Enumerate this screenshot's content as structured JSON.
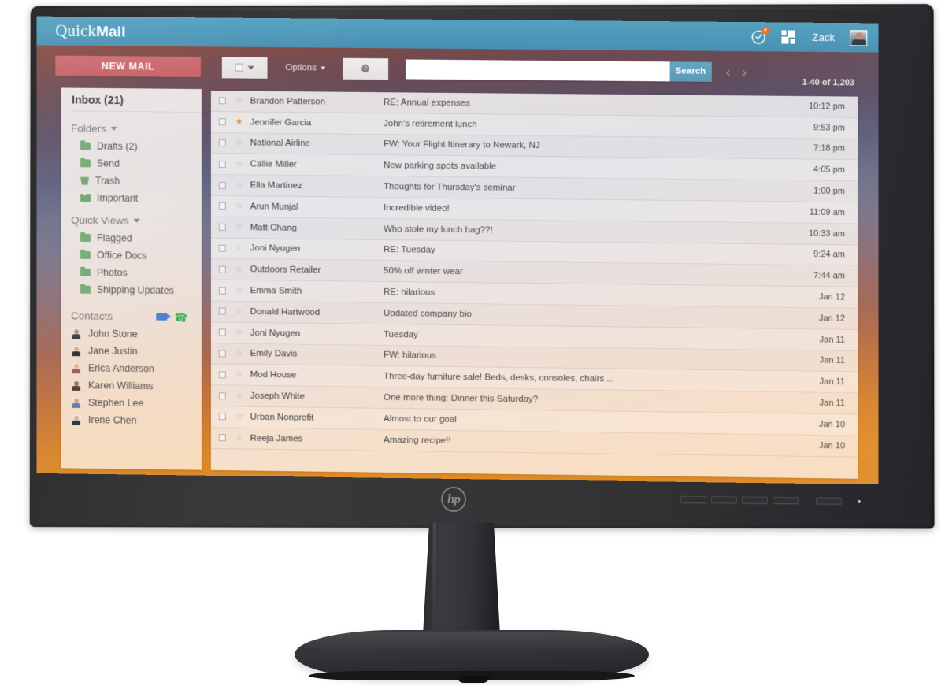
{
  "device": {
    "brand_logo": "hp",
    "brand_logo_icon": "hp-circle-logo",
    "osd_buttons": [
      "menu-button-1",
      "menu-button-2",
      "menu-button-3",
      "menu-button-4"
    ],
    "power_button": "power-button",
    "power_led": "power-led-indicator"
  },
  "app_bar": {
    "brand_light": "Quick",
    "brand_bold": "Mail",
    "notifications_icon": "clock-notification-icon",
    "notification_badge": "3",
    "apps_icon": "apps-grid-icon",
    "user_name": "Zack",
    "avatar_icon": "user-avatar"
  },
  "toolbar": {
    "new_mail_label": "NEW MAIL",
    "select_all_checkbox_icon": "checkbox-icon",
    "select_all_caret_icon": "chevron-down-icon",
    "options_label": "Options",
    "options_caret_icon": "chevron-down-icon",
    "settings_icon": "gear-icon",
    "search_value": "",
    "search_placeholder": "",
    "search_button_label": "Search",
    "prev_icon": "chevron-left-icon",
    "next_icon": "chevron-right-icon",
    "count_label": "1-40 of 1,203"
  },
  "sidebar": {
    "inbox_label": "Inbox (21)",
    "folders_section": {
      "label": "Folders",
      "caret_icon": "caret-down-icon"
    },
    "folders": [
      {
        "label": "Drafts (2)",
        "icon": "folder-icon"
      },
      {
        "label": "Send",
        "icon": "folder-icon"
      },
      {
        "label": "Trash",
        "icon": "trash-icon"
      },
      {
        "label": "Important",
        "icon": "starred-folder-icon"
      }
    ],
    "quick_views_section": {
      "label": "Quick Views",
      "caret_icon": "caret-down-icon"
    },
    "quick_views": [
      {
        "label": "Flagged",
        "icon": "folder-icon"
      },
      {
        "label": "Office Docs",
        "icon": "folder-icon"
      },
      {
        "label": "Photos",
        "icon": "folder-icon"
      },
      {
        "label": "Shipping Updates",
        "icon": "folder-icon"
      }
    ],
    "contacts_section": {
      "label": "Contacts",
      "video_icon": "video-camera-icon",
      "phone_icon": "phone-icon"
    },
    "contacts": [
      {
        "name": "John Stone"
      },
      {
        "name": "Jane Justin"
      },
      {
        "name": "Erica Anderson"
      },
      {
        "name": "Karen Williams"
      },
      {
        "name": "Stephen Lee"
      },
      {
        "name": "Irene Chen"
      }
    ]
  },
  "mail_list": {
    "rows": [
      {
        "sender": "Brandon Patterson",
        "subject": "RE: Annual expenses",
        "time": "10:12 pm",
        "starred": false
      },
      {
        "sender": "Jennifer Garcia",
        "subject": "John's retirement lunch",
        "time": "9:53 pm",
        "starred": true
      },
      {
        "sender": "National Airline",
        "subject": "FW: Your Flight Itinerary to Newark, NJ",
        "time": "7:18 pm",
        "starred": false
      },
      {
        "sender": "Callie Miller",
        "subject": "New parking spots available",
        "time": "4:05 pm",
        "starred": false
      },
      {
        "sender": "Ella Martinez",
        "subject": "Thoughts for Thursday's seminar",
        "time": "1:00 pm",
        "starred": false
      },
      {
        "sender": "Arun Munjal",
        "subject": "Incredible video!",
        "time": "11:09 am",
        "starred": false
      },
      {
        "sender": "Matt Chang",
        "subject": "Who stole my lunch bag??!",
        "time": "10:33 am",
        "starred": false
      },
      {
        "sender": "Joni Nyugen",
        "subject": "RE: Tuesday",
        "time": "9:24 am",
        "starred": false
      },
      {
        "sender": "Outdoors Retailer",
        "subject": "50% off winter wear",
        "time": "7:44 am",
        "starred": false
      },
      {
        "sender": "Emma Smith",
        "subject": "RE: hilarious",
        "time": "Jan 12",
        "starred": false
      },
      {
        "sender": "Donald Hartwood",
        "subject": "Updated company bio",
        "time": "Jan 12",
        "starred": false
      },
      {
        "sender": "Joni Nyugen",
        "subject": "Tuesday",
        "time": "Jan 11",
        "starred": false
      },
      {
        "sender": "Emily Davis",
        "subject": "FW: hilarious",
        "time": "Jan 11",
        "starred": false
      },
      {
        "sender": "Mod House",
        "subject": "Three-day furniture sale! Beds, desks, consoles, chairs ...",
        "time": "Jan 11",
        "starred": false
      },
      {
        "sender": "Joseph White",
        "subject": "One more thing: Dinner this Saturday?",
        "time": "Jan 11",
        "starred": false
      },
      {
        "sender": "Urban Nonprofit",
        "subject": "Almost to our goal",
        "time": "Jan 10",
        "starred": false
      },
      {
        "sender": "Reeja James",
        "subject": "Amazing recipe!!",
        "time": "Jan 10",
        "starred": false
      }
    ]
  },
  "colors": {
    "app_bar": "#4d98ba",
    "new_mail_button": "#c65f66",
    "search_button": "#5a9cb8",
    "star_active": "#e08a1e",
    "folder_green": "#74a973",
    "badge_orange": "#e8761f"
  }
}
